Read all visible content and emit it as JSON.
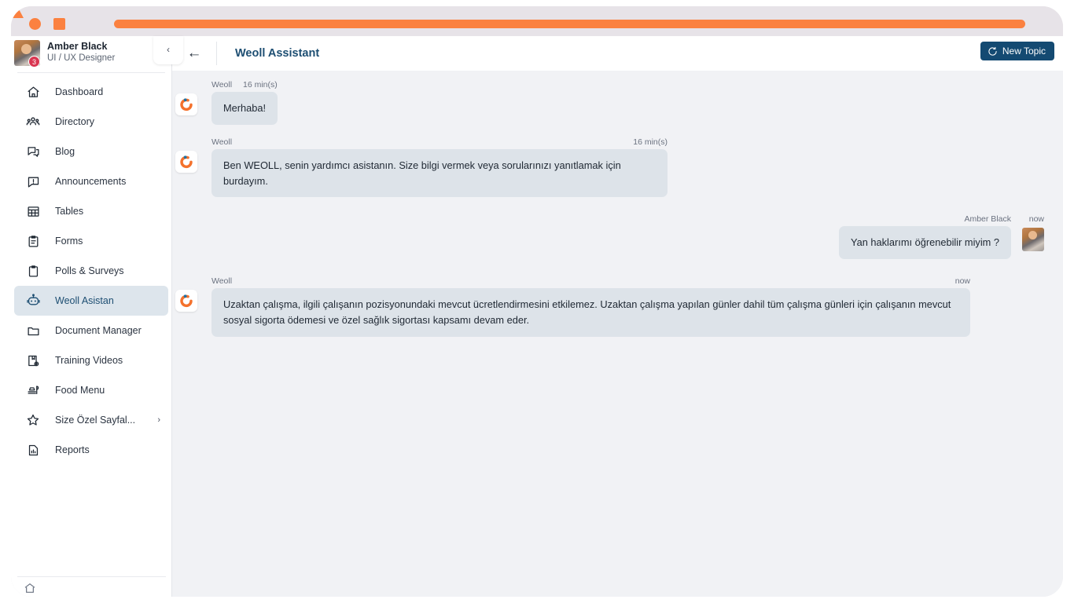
{
  "window": {
    "controls": [
      "circle",
      "square",
      "triangle"
    ],
    "url_bar_color": "#fb8140"
  },
  "sidebar": {
    "profile": {
      "name": "Amber Black",
      "role": "UI / UX Designer",
      "badge_count": "3",
      "collapse_icon": "‹"
    },
    "items": [
      {
        "label": "Dashboard",
        "icon": "home-icon",
        "active": false
      },
      {
        "label": "Directory",
        "icon": "people-icon",
        "active": false
      },
      {
        "label": "Blog",
        "icon": "chat-bubbles-icon",
        "active": false
      },
      {
        "label": "Announcements",
        "icon": "announcement-icon",
        "active": false
      },
      {
        "label": "Tables",
        "icon": "table-grid-icon",
        "active": false
      },
      {
        "label": "Forms",
        "icon": "clipboard-list-icon",
        "active": false
      },
      {
        "label": "Polls & Surveys",
        "icon": "clipboard-icon",
        "active": false
      },
      {
        "label": "Weoll Asistan",
        "icon": "robot-icon",
        "active": true
      },
      {
        "label": "Document Manager",
        "icon": "folder-icon",
        "active": false
      },
      {
        "label": "Training Videos",
        "icon": "video-book-icon",
        "active": false
      },
      {
        "label": "Food Menu",
        "icon": "food-tray-icon",
        "active": false
      },
      {
        "label": "Size Özel Sayfal...",
        "icon": "star-icon",
        "active": false,
        "chevron": "›"
      },
      {
        "label": "Reports",
        "icon": "report-chart-icon",
        "active": false
      }
    ],
    "cut_item": {
      "label": "",
      "icon": "partial-icon"
    }
  },
  "header": {
    "back_icon": "←",
    "title": "Weoll Assistant",
    "new_topic_label": "New Topic",
    "new_topic_icon": "history-refresh-icon",
    "new_topic_color": "#144a72"
  },
  "chat": {
    "messages": [
      {
        "sender": "Weoll",
        "time": "16 min(s)",
        "time_position": "inline",
        "side": "bot",
        "text": "Merhaba!",
        "width_class": "row-w1"
      },
      {
        "sender": "Weoll",
        "time": "16 min(s)",
        "time_position": "right",
        "side": "bot",
        "text": "Ben WEOLL, senin yardımcı asistanın. Size bilgi vermek veya sorularınızı yanıtlamak için burdayım.",
        "width_class": "row-w2"
      },
      {
        "sender": "Amber Black",
        "time": "now",
        "time_position": "right",
        "side": "user",
        "text": "Yan haklarımı öğrenebilir miyim ?",
        "width_class": "row-user"
      },
      {
        "sender": "Weoll",
        "time": "now",
        "time_position": "right",
        "side": "bot",
        "text": "Uzaktan çalışma, ilgili çalışanın pozisyonundaki mevcut ücretlendirmesini etkilemez. Uzaktan çalışma yapılan günler dahil tüm çalışma günleri için çalışanın mevcut sosyal sigorta ödemesi ve özel sağlık sigortası kapsamı devam eder.",
        "width_class": "row-w3"
      }
    ],
    "bubble_color": "#dde3e9"
  }
}
